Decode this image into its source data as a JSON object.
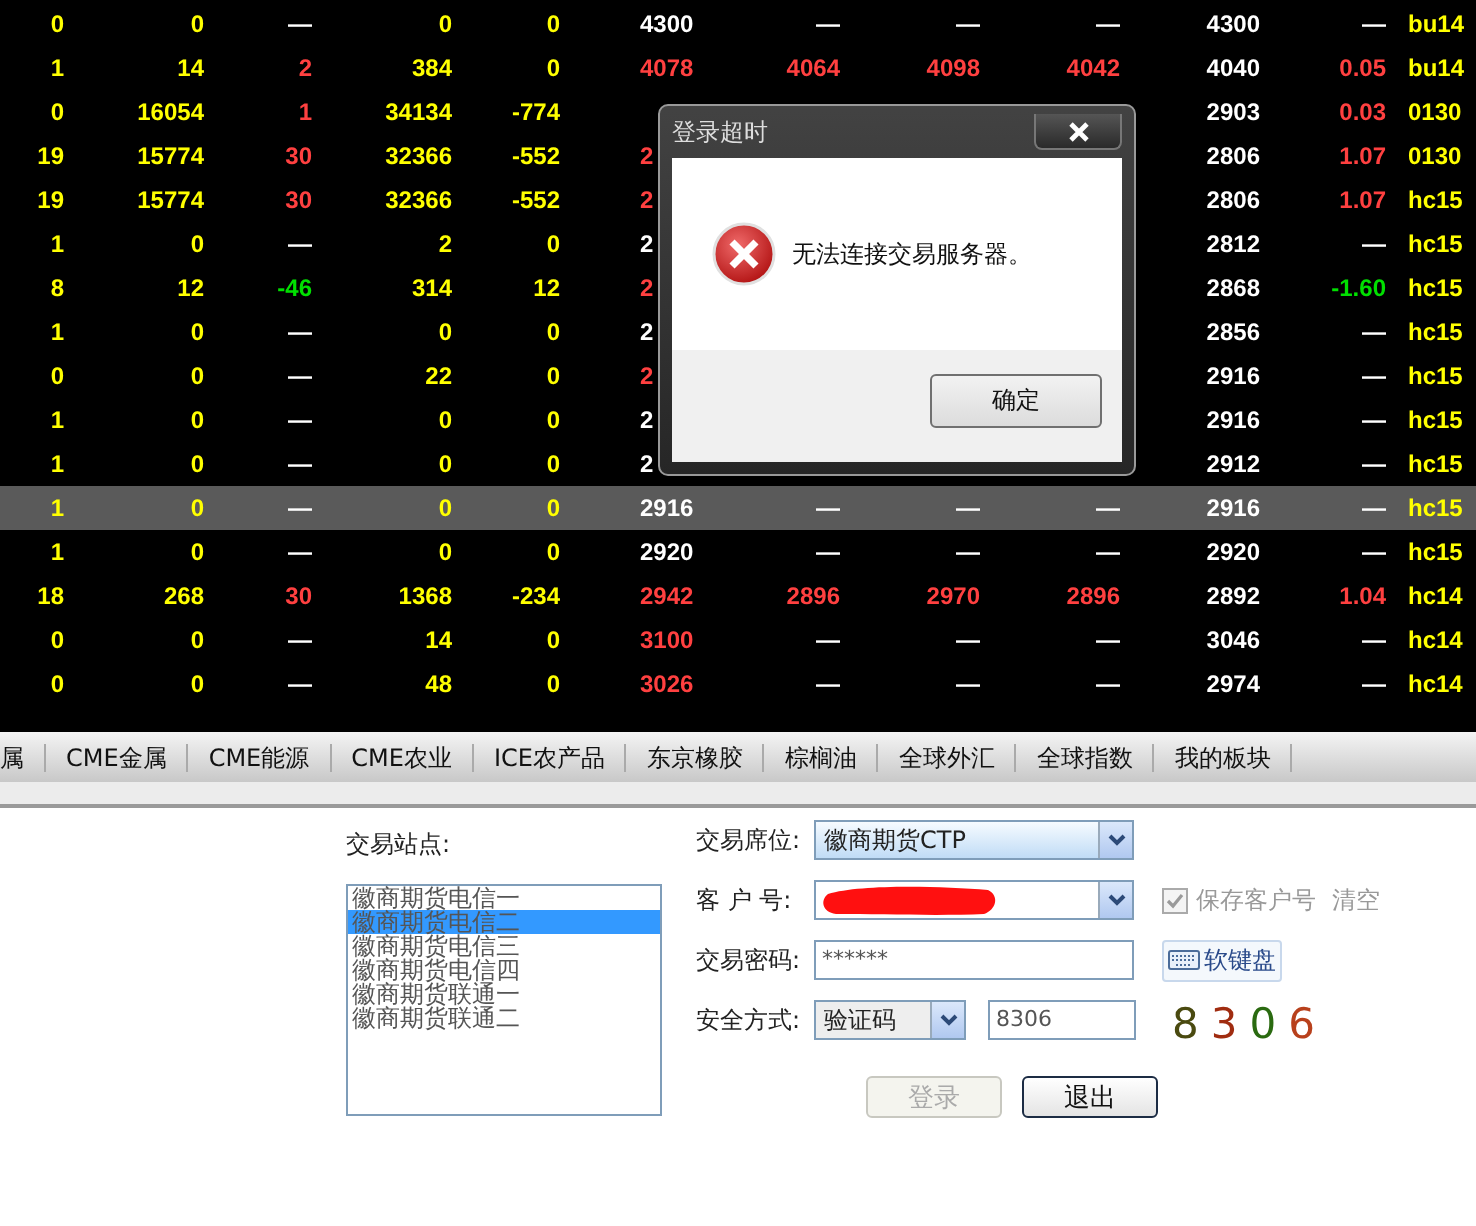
{
  "quote_table": {
    "rows": [
      {
        "selected": false,
        "cells": [
          {
            "text": "0",
            "color": "#ffff00"
          },
          {
            "text": "0",
            "color": "#ffff00"
          },
          {
            "text": "—",
            "color": "#ffffff"
          },
          {
            "text": "0",
            "color": "#ffff00"
          },
          {
            "text": "0",
            "color": "#ffff00"
          },
          {
            "text": "4300",
            "color": "#ffffff"
          },
          {
            "text": "—",
            "color": "#ffffff"
          },
          {
            "text": "—",
            "color": "#ffffff"
          },
          {
            "text": "—",
            "color": "#ffffff"
          },
          {
            "text": "4300",
            "color": "#ffffff"
          },
          {
            "text": "—",
            "color": "#ffffff"
          },
          {
            "text": "bu14",
            "color": "#ffff00"
          }
        ]
      },
      {
        "selected": false,
        "cells": [
          {
            "text": "1",
            "color": "#ffff00"
          },
          {
            "text": "14",
            "color": "#ffff00"
          },
          {
            "text": "2",
            "color": "#ff4040"
          },
          {
            "text": "384",
            "color": "#ffff00"
          },
          {
            "text": "0",
            "color": "#ffff00"
          },
          {
            "text": "4078",
            "color": "#ff4040"
          },
          {
            "text": "4064",
            "color": "#ff4040"
          },
          {
            "text": "4098",
            "color": "#ff4040"
          },
          {
            "text": "4042",
            "color": "#ff4040"
          },
          {
            "text": "4040",
            "color": "#ffffff"
          },
          {
            "text": "0.05",
            "color": "#ff4040"
          },
          {
            "text": "bu14",
            "color": "#ffff00"
          }
        ]
      },
      {
        "selected": false,
        "cells": [
          {
            "text": "0",
            "color": "#ffff00"
          },
          {
            "text": "16054",
            "color": "#ffff00"
          },
          {
            "text": "1",
            "color": "#ff4040"
          },
          {
            "text": "34134",
            "color": "#ffff00"
          },
          {
            "text": "-774",
            "color": "#ffff00"
          },
          null,
          null,
          null,
          null,
          {
            "text": "2903",
            "color": "#ffffff"
          },
          {
            "text": "0.03",
            "color": "#ff4040"
          },
          {
            "text": "0130",
            "color": "#ffff00"
          }
        ]
      },
      {
        "selected": false,
        "cells": [
          {
            "text": "19",
            "color": "#ffff00"
          },
          {
            "text": "15774",
            "color": "#ffff00"
          },
          {
            "text": "30",
            "color": "#ff4040"
          },
          {
            "text": "32366",
            "color": "#ffff00"
          },
          {
            "text": "-552",
            "color": "#ffff00"
          },
          {
            "text": "2",
            "color": "#ff4040"
          },
          null,
          null,
          null,
          {
            "text": "2806",
            "color": "#ffffff"
          },
          {
            "text": "1.07",
            "color": "#ff4040"
          },
          {
            "text": "0130",
            "color": "#ffff00"
          }
        ]
      },
      {
        "selected": false,
        "cells": [
          {
            "text": "19",
            "color": "#ffff00"
          },
          {
            "text": "15774",
            "color": "#ffff00"
          },
          {
            "text": "30",
            "color": "#ff4040"
          },
          {
            "text": "32366",
            "color": "#ffff00"
          },
          {
            "text": "-552",
            "color": "#ffff00"
          },
          {
            "text": "2",
            "color": "#ff4040"
          },
          null,
          null,
          null,
          {
            "text": "2806",
            "color": "#ffffff"
          },
          {
            "text": "1.07",
            "color": "#ff4040"
          },
          {
            "text": "hc15",
            "color": "#ffff00"
          }
        ]
      },
      {
        "selected": false,
        "cells": [
          {
            "text": "1",
            "color": "#ffff00"
          },
          {
            "text": "0",
            "color": "#ffff00"
          },
          {
            "text": "—",
            "color": "#ffffff"
          },
          {
            "text": "2",
            "color": "#ffff00"
          },
          {
            "text": "0",
            "color": "#ffff00"
          },
          {
            "text": "2",
            "color": "#ffffff"
          },
          null,
          null,
          null,
          {
            "text": "2812",
            "color": "#ffffff"
          },
          {
            "text": "—",
            "color": "#ffffff"
          },
          {
            "text": "hc15",
            "color": "#ffff00"
          }
        ]
      },
      {
        "selected": false,
        "cells": [
          {
            "text": "8",
            "color": "#ffff00"
          },
          {
            "text": "12",
            "color": "#ffff00"
          },
          {
            "text": "-46",
            "color": "#00e000"
          },
          {
            "text": "314",
            "color": "#ffff00"
          },
          {
            "text": "12",
            "color": "#ffff00"
          },
          {
            "text": "2",
            "color": "#ff4040"
          },
          null,
          null,
          null,
          {
            "text": "2868",
            "color": "#ffffff"
          },
          {
            "text": "-1.60",
            "color": "#00e000"
          },
          {
            "text": "hc15",
            "color": "#ffff00"
          }
        ]
      },
      {
        "selected": false,
        "cells": [
          {
            "text": "1",
            "color": "#ffff00"
          },
          {
            "text": "0",
            "color": "#ffff00"
          },
          {
            "text": "—",
            "color": "#ffffff"
          },
          {
            "text": "0",
            "color": "#ffff00"
          },
          {
            "text": "0",
            "color": "#ffff00"
          },
          {
            "text": "2",
            "color": "#ffffff"
          },
          null,
          null,
          null,
          {
            "text": "2856",
            "color": "#ffffff"
          },
          {
            "text": "—",
            "color": "#ffffff"
          },
          {
            "text": "hc15",
            "color": "#ffff00"
          }
        ]
      },
      {
        "selected": false,
        "cells": [
          {
            "text": "0",
            "color": "#ffff00"
          },
          {
            "text": "0",
            "color": "#ffff00"
          },
          {
            "text": "—",
            "color": "#ffffff"
          },
          {
            "text": "22",
            "color": "#ffff00"
          },
          {
            "text": "0",
            "color": "#ffff00"
          },
          {
            "text": "2",
            "color": "#ff4040"
          },
          null,
          null,
          null,
          {
            "text": "2916",
            "color": "#ffffff"
          },
          {
            "text": "—",
            "color": "#ffffff"
          },
          {
            "text": "hc15",
            "color": "#ffff00"
          }
        ]
      },
      {
        "selected": false,
        "cells": [
          {
            "text": "1",
            "color": "#ffff00"
          },
          {
            "text": "0",
            "color": "#ffff00"
          },
          {
            "text": "—",
            "color": "#ffffff"
          },
          {
            "text": "0",
            "color": "#ffff00"
          },
          {
            "text": "0",
            "color": "#ffff00"
          },
          {
            "text": "2",
            "color": "#ffffff"
          },
          null,
          null,
          null,
          {
            "text": "2916",
            "color": "#ffffff"
          },
          {
            "text": "—",
            "color": "#ffffff"
          },
          {
            "text": "hc15",
            "color": "#ffff00"
          }
        ]
      },
      {
        "selected": false,
        "cells": [
          {
            "text": "1",
            "color": "#ffff00"
          },
          {
            "text": "0",
            "color": "#ffff00"
          },
          {
            "text": "—",
            "color": "#ffffff"
          },
          {
            "text": "0",
            "color": "#ffff00"
          },
          {
            "text": "0",
            "color": "#ffff00"
          },
          {
            "text": "2",
            "color": "#ffffff"
          },
          null,
          null,
          null,
          {
            "text": "2912",
            "color": "#ffffff"
          },
          {
            "text": "—",
            "color": "#ffffff"
          },
          {
            "text": "hc15",
            "color": "#ffff00"
          }
        ]
      },
      {
        "selected": true,
        "cells": [
          {
            "text": "1",
            "color": "#ffff00"
          },
          {
            "text": "0",
            "color": "#ffff00"
          },
          {
            "text": "—",
            "color": "#ffffff"
          },
          {
            "text": "0",
            "color": "#ffff00"
          },
          {
            "text": "0",
            "color": "#ffff00"
          },
          {
            "text": "2916",
            "color": "#ffffff"
          },
          {
            "text": "—",
            "color": "#ffffff"
          },
          {
            "text": "—",
            "color": "#ffffff"
          },
          {
            "text": "—",
            "color": "#ffffff"
          },
          {
            "text": "2916",
            "color": "#ffffff"
          },
          {
            "text": "—",
            "color": "#ffffff"
          },
          {
            "text": "hc15",
            "color": "#ffff00"
          }
        ]
      },
      {
        "selected": false,
        "cells": [
          {
            "text": "1",
            "color": "#ffff00"
          },
          {
            "text": "0",
            "color": "#ffff00"
          },
          {
            "text": "—",
            "color": "#ffffff"
          },
          {
            "text": "0",
            "color": "#ffff00"
          },
          {
            "text": "0",
            "color": "#ffff00"
          },
          {
            "text": "2920",
            "color": "#ffffff"
          },
          {
            "text": "—",
            "color": "#ffffff"
          },
          {
            "text": "—",
            "color": "#ffffff"
          },
          {
            "text": "—",
            "color": "#ffffff"
          },
          {
            "text": "2920",
            "color": "#ffffff"
          },
          {
            "text": "—",
            "color": "#ffffff"
          },
          {
            "text": "hc15",
            "color": "#ffff00"
          }
        ]
      },
      {
        "selected": false,
        "cells": [
          {
            "text": "18",
            "color": "#ffff00"
          },
          {
            "text": "268",
            "color": "#ffff00"
          },
          {
            "text": "30",
            "color": "#ff4040"
          },
          {
            "text": "1368",
            "color": "#ffff00"
          },
          {
            "text": "-234",
            "color": "#ffff00"
          },
          {
            "text": "2942",
            "color": "#ff4040"
          },
          {
            "text": "2896",
            "color": "#ff4040"
          },
          {
            "text": "2970",
            "color": "#ff4040"
          },
          {
            "text": "2896",
            "color": "#ff4040"
          },
          {
            "text": "2892",
            "color": "#ffffff"
          },
          {
            "text": "1.04",
            "color": "#ff4040"
          },
          {
            "text": "hc14",
            "color": "#ffff00"
          }
        ]
      },
      {
        "selected": false,
        "cells": [
          {
            "text": "0",
            "color": "#ffff00"
          },
          {
            "text": "0",
            "color": "#ffff00"
          },
          {
            "text": "—",
            "color": "#ffffff"
          },
          {
            "text": "14",
            "color": "#ffff00"
          },
          {
            "text": "0",
            "color": "#ffff00"
          },
          {
            "text": "3100",
            "color": "#ff4040"
          },
          {
            "text": "—",
            "color": "#ffffff"
          },
          {
            "text": "—",
            "color": "#ffffff"
          },
          {
            "text": "—",
            "color": "#ffffff"
          },
          {
            "text": "3046",
            "color": "#ffffff"
          },
          {
            "text": "—",
            "color": "#ffffff"
          },
          {
            "text": "hc14",
            "color": "#ffff00"
          }
        ]
      },
      {
        "selected": false,
        "cells": [
          {
            "text": "0",
            "color": "#ffff00"
          },
          {
            "text": "0",
            "color": "#ffff00"
          },
          {
            "text": "—",
            "color": "#ffffff"
          },
          {
            "text": "48",
            "color": "#ffff00"
          },
          {
            "text": "0",
            "color": "#ffff00"
          },
          {
            "text": "3026",
            "color": "#ff4040"
          },
          {
            "text": "—",
            "color": "#ffffff"
          },
          {
            "text": "—",
            "color": "#ffffff"
          },
          {
            "text": "—",
            "color": "#ffffff"
          },
          {
            "text": "2974",
            "color": "#ffffff"
          },
          {
            "text": "—",
            "color": "#ffffff"
          },
          {
            "text": "hc14",
            "color": "#ffff00"
          }
        ]
      }
    ]
  },
  "market_tabs": [
    {
      "label": "属",
      "selected": false
    },
    {
      "label": "CME金属",
      "selected": false
    },
    {
      "label": "CME能源",
      "selected": false
    },
    {
      "label": "CME农业",
      "selected": false
    },
    {
      "label": "ICE农产品",
      "selected": false
    },
    {
      "label": "东京橡胶",
      "selected": false
    },
    {
      "label": "棕榈油",
      "selected": false
    },
    {
      "label": "全球外汇",
      "selected": false
    },
    {
      "label": "全球指数",
      "selected": false
    },
    {
      "label": "我的板块",
      "selected": false
    }
  ],
  "login": {
    "site_label": "交易站点:",
    "sites": [
      {
        "label": "徽商期货电信一",
        "selected": false
      },
      {
        "label": "徽商期货电信二",
        "selected": true
      },
      {
        "label": "徽商期货电信三",
        "selected": false
      },
      {
        "label": "徽商期货电信四",
        "selected": false
      },
      {
        "label": "徽商期货联通一",
        "selected": false
      },
      {
        "label": "徽商期货联通二",
        "selected": false
      }
    ],
    "seat_label": "交易席位:",
    "seat_value": "徽商期货CTP",
    "account_label": "客 户 号:",
    "account_redacted": true,
    "save_account": {
      "label": "保存客户号",
      "checked": true,
      "disabled": true
    },
    "clear_link": "清空",
    "password_label": "交易密码:",
    "password_value": "******",
    "soft_keyboard": "软键盘",
    "security_label": "安全方式:",
    "security_value": "验证码",
    "code_value": "8306",
    "captcha": [
      {
        "digit": "8",
        "color": "#4a4a10"
      },
      {
        "digit": "3",
        "color": "#a02c10"
      },
      {
        "digit": "0",
        "color": "#2a6a10"
      },
      {
        "digit": "6",
        "color": "#b8401c"
      }
    ],
    "buttons": [
      {
        "label": "登录",
        "disabled": true
      },
      {
        "label": "退出",
        "disabled": false
      }
    ]
  },
  "dialog": {
    "title": "登录超时",
    "message": "无法连接交易服务器。",
    "button": "确定"
  }
}
